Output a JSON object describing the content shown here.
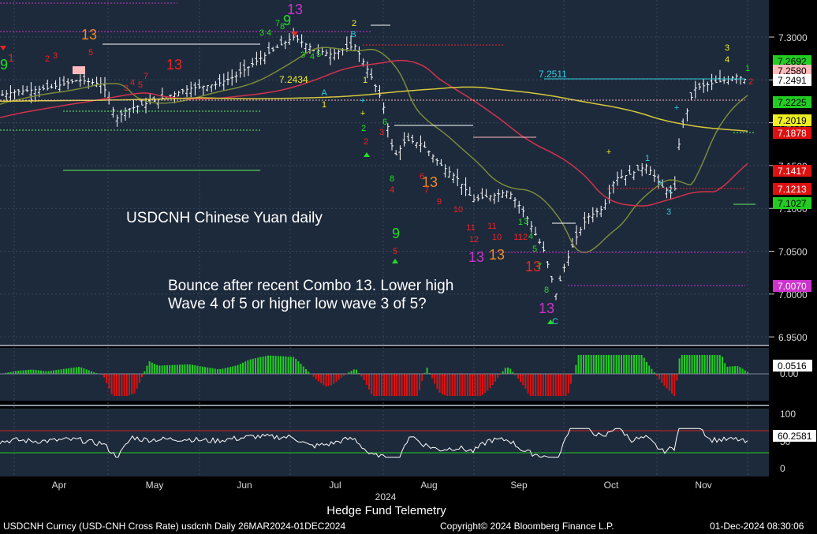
{
  "colors": {
    "panel_bg": "#1d2a3c",
    "grid": "#3a4658",
    "price_bars": "#ffffff",
    "ma_red": "#d4324a",
    "ma_yellow": "#d6c83a",
    "ma_green": "#7a8a3a",
    "macd_up": "#22cc22",
    "macd_down": "#dd1111",
    "rsi_line": "#ffffff",
    "rsi_upper": "#cc2222",
    "rsi_lower": "#22cc22",
    "seq_green": "#22dd22",
    "seq_red": "#ee2222",
    "seq_orange": "#ee8a22",
    "seq_magenta": "#cc33cc",
    "seq_yellow": "#eeee22",
    "seq_cyan": "#33ccdd"
  },
  "chart_data": {
    "type": "candlestick",
    "title": "USDCNH Chinese Yuan daily",
    "annotation_lines": [
      "Bounce after recent Combo 13.  Lower high",
      "Wave 4 of 5 or higher low wave 3 of 5?"
    ],
    "price_panel": {
      "ylim": [
        6.93,
        7.335
      ],
      "y_ticks": [
        "7.3000",
        "7.2500",
        "7.2000",
        "7.1500",
        "7.1000",
        "7.0500",
        "7.0000",
        "6.9500"
      ],
      "x_ticks": [
        "Apr",
        "May",
        "Jun",
        "Jul",
        "Aug",
        "Sep",
        "Oct",
        "Nov"
      ],
      "year_label": "2024",
      "ohlc_close_approx": [
        {
          "date": "2024-03-26",
          "close": 7.232
        },
        {
          "date": "2024-04-01",
          "close": 7.236
        },
        {
          "date": "2024-04-08",
          "close": 7.238
        },
        {
          "date": "2024-04-15",
          "close": 7.247
        },
        {
          "date": "2024-04-22",
          "close": 7.25
        },
        {
          "date": "2024-04-29",
          "close": 7.205
        },
        {
          "date": "2024-05-06",
          "close": 7.225
        },
        {
          "date": "2024-05-13",
          "close": 7.225
        },
        {
          "date": "2024-05-20",
          "close": 7.245
        },
        {
          "date": "2024-05-27",
          "close": 7.24
        },
        {
          "date": "2024-06-03",
          "close": 7.245
        },
        {
          "date": "2024-06-10",
          "close": 7.265
        },
        {
          "date": "2024-06-17",
          "close": 7.285
        },
        {
          "date": "2024-06-24",
          "close": 7.3
        },
        {
          "date": "2024-07-01",
          "close": 7.28
        },
        {
          "date": "2024-07-08",
          "close": 7.275
        },
        {
          "date": "2024-07-15",
          "close": 7.275
        },
        {
          "date": "2024-07-22",
          "close": 7.24
        },
        {
          "date": "2024-07-29",
          "close": 7.16
        },
        {
          "date": "2024-08-05",
          "close": 7.175
        },
        {
          "date": "2024-08-12",
          "close": 7.15
        },
        {
          "date": "2024-08-19",
          "close": 7.13
        },
        {
          "date": "2024-08-26",
          "close": 7.1
        },
        {
          "date": "2024-09-02",
          "close": 7.115
        },
        {
          "date": "2024-09-09",
          "close": 7.1
        },
        {
          "date": "2024-09-16",
          "close": 7.05
        },
        {
          "date": "2024-09-23",
          "close": 7.0
        },
        {
          "date": "2024-09-30",
          "close": 7.055
        },
        {
          "date": "2024-10-07",
          "close": 7.08
        },
        {
          "date": "2024-10-14",
          "close": 7.135
        },
        {
          "date": "2024-10-21",
          "close": 7.14
        },
        {
          "date": "2024-10-28",
          "close": 7.12
        },
        {
          "date": "2024-11-04",
          "close": 7.205
        },
        {
          "date": "2024-11-11",
          "close": 7.245
        },
        {
          "date": "2024-11-18",
          "close": 7.24
        },
        {
          "date": "2024-11-25",
          "close": 7.249
        }
      ],
      "price_labels": [
        {
          "value": 7.2692,
          "text": "7.2692",
          "bg": "#22cc22",
          "fg": "#000000"
        },
        {
          "value": 7.258,
          "text": "7.2580",
          "bg": "#ffbbbb",
          "fg": "#000000"
        },
        {
          "value": 7.2491,
          "text": "7.2491",
          "bg": "#ffffff",
          "fg": "#000000"
        },
        {
          "value": 7.2225,
          "text": "7.2225",
          "bg": "#22cc22",
          "fg": "#000000"
        },
        {
          "value": 7.2019,
          "text": "7.2019",
          "bg": "#eeee22",
          "fg": "#000000"
        },
        {
          "value": 7.1878,
          "text": "7.1878",
          "bg": "#dd1111",
          "fg": "#ffffff"
        },
        {
          "value": 7.1417,
          "text": "7.1417",
          "bg": "#dd1111",
          "fg": "#ffffff"
        },
        {
          "value": 7.1213,
          "text": "7.1213",
          "bg": "#dd1111",
          "fg": "#ffffff"
        },
        {
          "value": 7.1027,
          "text": "7.1027",
          "bg": "#22cc22",
          "fg": "#000000"
        },
        {
          "value": 7.007,
          "text": "7.0070",
          "bg": "#cc33cc",
          "fg": "#ffffff"
        }
      ],
      "inline_labels": [
        {
          "text": "7.2434",
          "color": "#eeee22"
        },
        {
          "text": "7.2511",
          "color": "#33ccdd"
        }
      ],
      "sequential_counts": [
        {
          "text": "9",
          "color": "#22dd22"
        },
        {
          "text": "1",
          "color": "#ee2222"
        },
        {
          "text": "13",
          "color": "#ee8a22"
        },
        {
          "text": "13",
          "color": "#ee2222"
        },
        {
          "text": "13",
          "color": "#cc33cc"
        },
        {
          "text": "9",
          "color": "#22dd22"
        },
        {
          "text": "9",
          "color": "#22dd22"
        },
        {
          "text": "13",
          "color": "#ee8a22"
        },
        {
          "text": "13",
          "color": "#cc33cc"
        },
        {
          "text": "13",
          "color": "#ee8a22"
        },
        {
          "text": "13",
          "color": "#ee2222"
        },
        {
          "text": "13",
          "color": "#cc33cc"
        },
        {
          "text": "3",
          "color": "#eeee22"
        },
        {
          "text": "4",
          "color": "#eeee22"
        },
        {
          "text": "2",
          "color": "#eeee22"
        },
        {
          "text": "5",
          "color": "#ee2222"
        },
        {
          "text": "C",
          "color": "#33ccdd"
        },
        {
          "text": "B",
          "color": "#33ccdd"
        },
        {
          "text": "A",
          "color": "#33ccdd"
        },
        {
          "text": "1",
          "color": "#eeee22"
        }
      ]
    },
    "macd_panel": {
      "last_value": "0.0516",
      "y_ticks": [
        "0.00"
      ]
    },
    "rsi_panel": {
      "last_value": "60.2581",
      "y_ticks": [
        "100",
        "50",
        "0"
      ],
      "upper_line": 70,
      "lower_line": 30
    }
  },
  "footer": {
    "center_title": "Hedge Fund Telemetry",
    "left_info": "USDCNH Curncy (USD-CNH Cross Rate) usdcnh  Daily 26MAR2024-01DEC2024",
    "copyright": "Copyright© 2024 Bloomberg Finance L.P.",
    "timestamp": "01-Dec-2024 08:30:06"
  }
}
